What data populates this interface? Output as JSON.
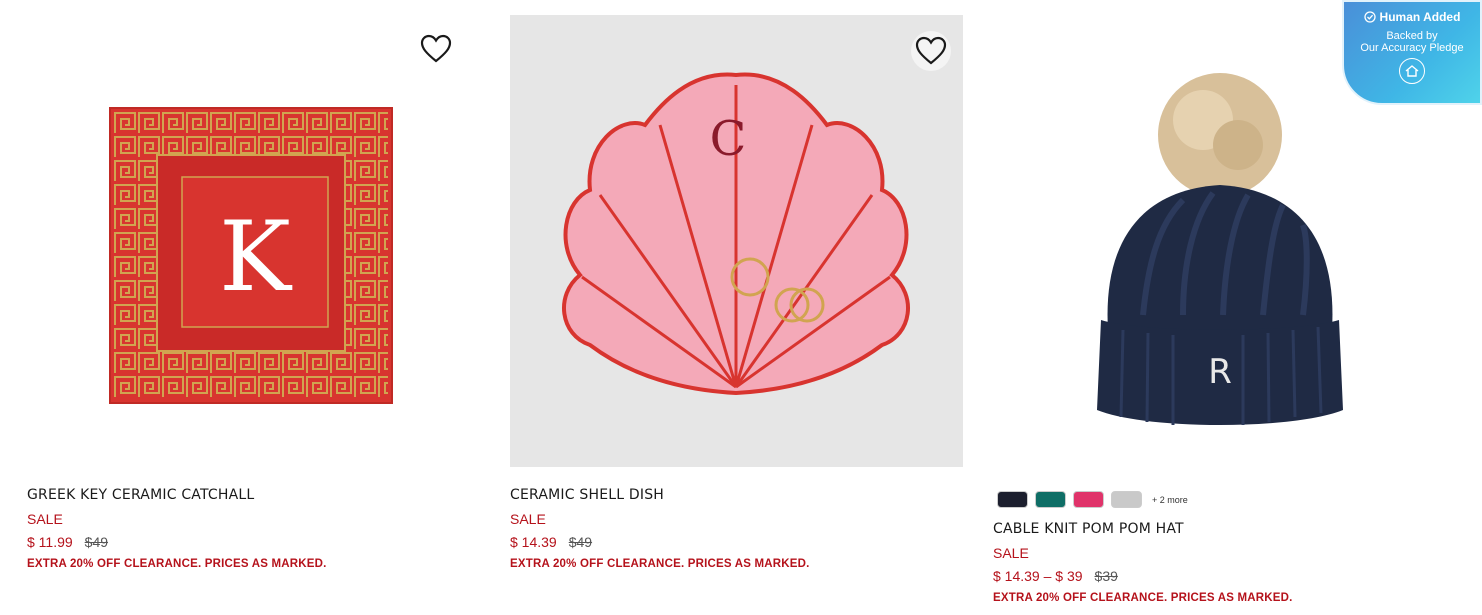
{
  "products": [
    {
      "title": "GREEK KEY CERAMIC CATCHALL",
      "sale_label": "SALE",
      "price": "$ 11.99",
      "was_price": "$49",
      "promo": "EXTRA 20% OFF CLEARANCE. PRICES AS MARKED.",
      "monogram": "K"
    },
    {
      "title": "CERAMIC SHELL DISH",
      "sale_label": "SALE",
      "price": "$ 14.39",
      "was_price": "$49",
      "promo": "EXTRA 20% OFF CLEARANCE. PRICES AS MARKED.",
      "monogram": "C"
    },
    {
      "title": "CABLE KNIT POM POM HAT",
      "sale_label": "SALE",
      "price": "$ 14.39 – $ 39",
      "was_price": "$39",
      "promo": "EXTRA 20% OFF CLEARANCE. PRICES AS MARKED.",
      "monogram": "R",
      "swatches": [
        "#1c1f2e",
        "#0f6e66",
        "#e0336a",
        "#c9c9c9"
      ],
      "more_colors": "+ 2 more"
    }
  ],
  "badge": {
    "line1": "Human Added",
    "line2": "Backed by",
    "line3": "Our Accuracy Pledge"
  },
  "colors": {
    "sale_red": "#b5121b",
    "dish_red": "#d8342f",
    "dish_gold": "#d1a450",
    "shell_pink": "#f4a9b8",
    "hat_navy": "#1f2a44",
    "pompom": "#d8c09a"
  }
}
